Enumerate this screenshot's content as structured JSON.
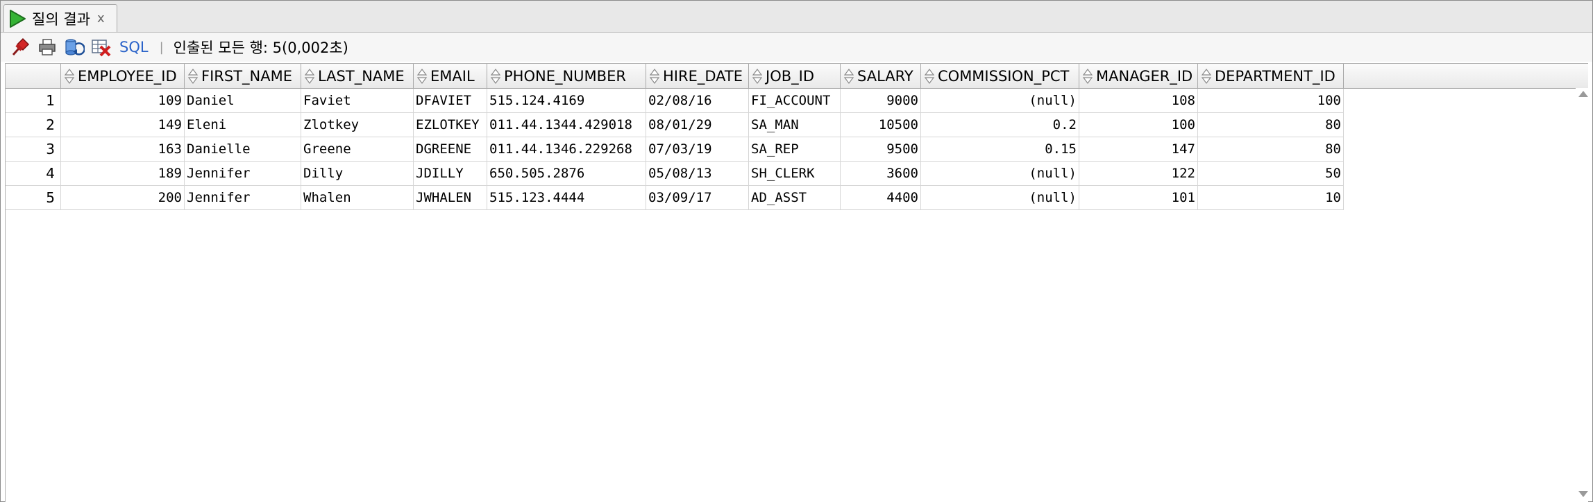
{
  "tab": {
    "label": "질의 결과",
    "close": "x"
  },
  "toolbar": {
    "sql_label": "SQL",
    "separator": "|",
    "status": "인출된 모든 행: 5(0,002초)",
    "icons": [
      "pin-icon",
      "print-icon",
      "refresh-icon",
      "delete-icon"
    ]
  },
  "grid": {
    "columns": [
      {
        "label": "EMPLOYEE_ID",
        "width": 178,
        "align": "right"
      },
      {
        "label": "FIRST_NAME",
        "width": 168,
        "align": "left"
      },
      {
        "label": "LAST_NAME",
        "width": 162,
        "align": "left"
      },
      {
        "label": "EMAIL",
        "width": 106,
        "align": "left"
      },
      {
        "label": "PHONE_NUMBER",
        "width": 229,
        "align": "left"
      },
      {
        "label": "HIRE_DATE",
        "width": 148,
        "align": "left"
      },
      {
        "label": "JOB_ID",
        "width": 132,
        "align": "left"
      },
      {
        "label": "SALARY",
        "width": 116,
        "align": "right"
      },
      {
        "label": "COMMISSION_PCT",
        "width": 228,
        "align": "right"
      },
      {
        "label": "MANAGER_ID",
        "width": 171,
        "align": "right"
      },
      {
        "label": "DEPARTMENT_ID",
        "width": 210,
        "align": "right"
      }
    ],
    "rows": [
      {
        "num": "1",
        "cells": [
          "109",
          "Daniel",
          "Faviet",
          "DFAVIET",
          "515.124.4169",
          "02/08/16",
          "FI_ACCOUNT",
          "9000",
          "(null)",
          "108",
          "100"
        ]
      },
      {
        "num": "2",
        "cells": [
          "149",
          "Eleni",
          "Zlotkey",
          "EZLOTKEY",
          "011.44.1344.429018",
          "08/01/29",
          "SA_MAN",
          "10500",
          "0.2",
          "100",
          "80"
        ]
      },
      {
        "num": "3",
        "cells": [
          "163",
          "Danielle",
          "Greene",
          "DGREENE",
          "011.44.1346.229268",
          "07/03/19",
          "SA_REP",
          "9500",
          "0.15",
          "147",
          "80"
        ]
      },
      {
        "num": "4",
        "cells": [
          "189",
          "Jennifer",
          "Dilly",
          "JDILLY",
          "650.505.2876",
          "05/08/13",
          "SH_CLERK",
          "3600",
          "(null)",
          "122",
          "50"
        ]
      },
      {
        "num": "5",
        "cells": [
          "200",
          "Jennifer",
          "Whalen",
          "JWHALEN",
          "515.123.4444",
          "03/09/17",
          "AD_ASST",
          "4400",
          "(null)",
          "101",
          "10"
        ]
      }
    ]
  },
  "colors": {
    "run_green": "#2fa12f",
    "sql_blue": "#2a63c9"
  }
}
